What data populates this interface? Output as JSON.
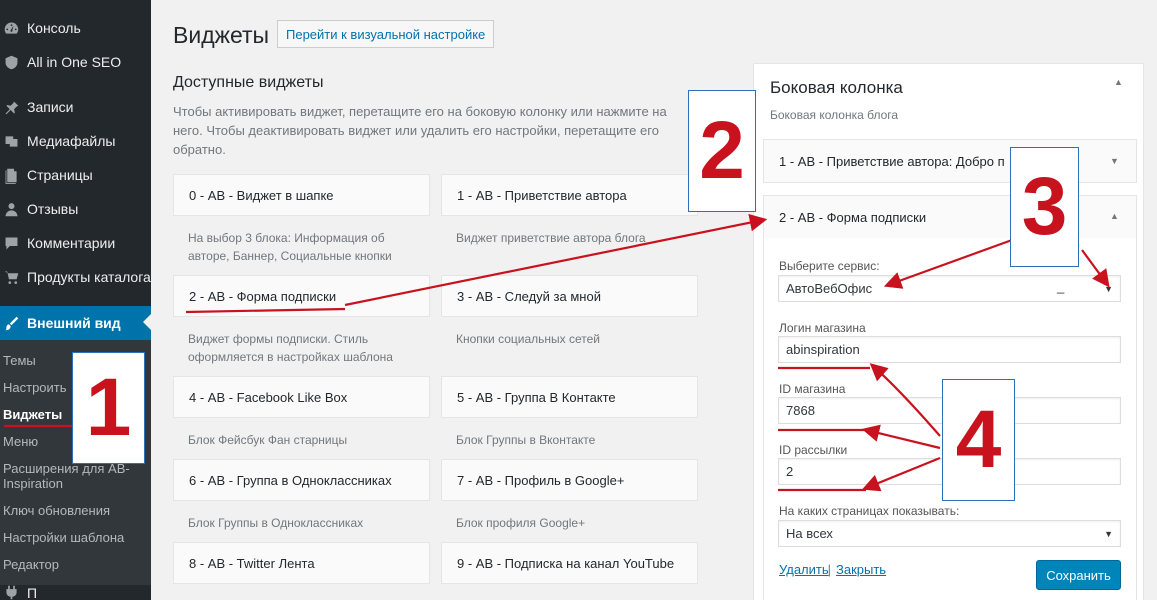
{
  "sidebar": {
    "items": [
      {
        "label": "Консоль",
        "icon": "dashboard-icon"
      },
      {
        "label": "All in One SEO",
        "icon": "shield-icon"
      },
      {
        "label": "Записи",
        "icon": "pin-icon"
      },
      {
        "label": "Медиафайлы",
        "icon": "media-icon"
      },
      {
        "label": "Страницы",
        "icon": "pages-icon"
      },
      {
        "label": "Отзывы",
        "icon": "person-icon"
      },
      {
        "label": "Комментарии",
        "icon": "comment-icon"
      },
      {
        "label": "Продукты каталога",
        "icon": "cart-icon"
      },
      {
        "label": "Внешний вид",
        "icon": "brush-icon"
      }
    ],
    "submenu": [
      "Темы",
      "Настроить",
      "Виджеты",
      "Меню",
      "Расширения для АВ-Inspiration",
      "Ключ обновления",
      "Настройки шаблона",
      "Редактор"
    ],
    "bottom_partial": "П"
  },
  "header": {
    "title": "Виджеты",
    "customize_label": "Перейти к визуальной настройке"
  },
  "available": {
    "title": "Доступные виджеты",
    "description": "Чтобы активировать виджет, перетащите его на боковую колонку или нажмите на него. Чтобы деактивировать виджет или удалить его настройки, перетащите его обратно.",
    "widgets": [
      {
        "name": "0 - АВ - Виджет в шапке",
        "desc": "На выбор 3 блока: Информация об авторе, Баннер, Социальные кнопки"
      },
      {
        "name": "1 - АВ - Приветствие автора",
        "desc": "Виджет приветствие автора блога"
      },
      {
        "name": "2 - АВ - Форма подписки",
        "desc": "Виджет формы подписки. Стиль оформляется в настройках шаблона"
      },
      {
        "name": "3 - АВ - Следуй за мной",
        "desc": "Кнопки социальных сетей"
      },
      {
        "name": "4 - АВ - Facebook Like Box",
        "desc": "Блок Фейсбук Фан старницы"
      },
      {
        "name": "5 - АВ - Группа В Контакте",
        "desc": "Блок Группы в Вконтакте"
      },
      {
        "name": "6 - АВ - Группа в Одноклассниках",
        "desc": "Блок Группы в Одноклассниках"
      },
      {
        "name": "7 - АВ - Профиль в Google+",
        "desc": "Блок профиля Google+"
      },
      {
        "name": "8 - АВ - Twitter Лента",
        "desc": ""
      },
      {
        "name": "9 - АВ - Подписка на канал YouTube",
        "desc": ""
      }
    ]
  },
  "sidebar_area": {
    "title": "Боковая колонка",
    "description": "Боковая колонка блога",
    "widget1": {
      "name": "1 - АВ - Приветствие автора",
      "suffix": ": Добро п"
    },
    "widget2": {
      "name": "2 - АВ - Форма подписки"
    },
    "form": {
      "service_label": "Выберите сервис:",
      "service_value": "АвтоВебОфис",
      "service_extra": "_",
      "login_label": "Логин магазина",
      "login_value": "abinspiration",
      "shop_id_label": "ID магазина",
      "shop_id_value": "7868",
      "mailing_id_label": "ID рассылки",
      "mailing_id_value": "2",
      "pages_label": "На каких страницах показывать:",
      "pages_value": "На всех",
      "delete_label": "Удалить",
      "separator": " | ",
      "close_label": "Закрыть",
      "save_label": "Сохранить"
    }
  },
  "annotations": {
    "n1": "1",
    "n2": "2",
    "n3": "3",
    "n4": "4",
    "color": "#c8131f"
  }
}
